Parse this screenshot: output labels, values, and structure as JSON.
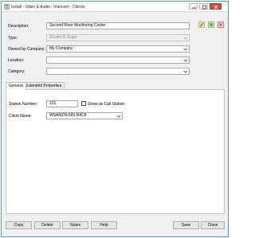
{
  "window": {
    "title": "Install - Video & Audio - Intercom - Clients"
  },
  "form": {
    "description_label": "Description:",
    "description_value": "Second Floor Monitoring Center",
    "type_label": "Type:",
    "type_value": "Zenitel IC-Edge",
    "owned_by_label": "Owned by Company:",
    "owned_by_value": "My Company",
    "location_label": "Location:",
    "location_value": "",
    "category_label": "Category:",
    "category_value": ""
  },
  "tabs": {
    "general": "General",
    "extended": "Extended Properties"
  },
  "general": {
    "station_number_label": "Station Number:",
    "station_number_value": "101",
    "show_as_call_station_label": "Show as Call Station",
    "show_as_call_station_checked": false,
    "client_name_label": "Client Name:",
    "client_name_value": "WSAMZN-5I5LN4C8"
  },
  "buttons": {
    "copy": "Copy",
    "delete": "Delete",
    "notes": "Notes",
    "help": "Help",
    "save": "Save",
    "close": "Close"
  },
  "icons": {
    "toolbar": [
      "edit-icon",
      "export-icon",
      "delete-icon"
    ]
  },
  "colors": {
    "close_button": "#c7504a",
    "window_border": "#6d8fb8"
  }
}
